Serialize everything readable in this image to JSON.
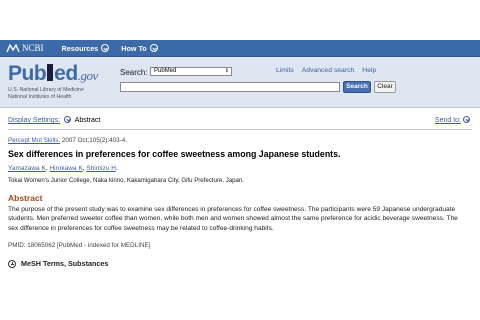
{
  "topbar": {
    "ncbi_label": "NCBI",
    "menus": [
      "Resources",
      "How To"
    ]
  },
  "header": {
    "logo_left": "Pub",
    "logo_right": "ed",
    "logo_gov": ".gov",
    "logo_sub1": "U.S. National Library of Medicine",
    "logo_sub2": "National Institutes of Health",
    "search_label": "Search:",
    "db_selected": "PubMed",
    "links": [
      "Limits",
      "Advanced search",
      "Help"
    ],
    "search_value": "",
    "search_button": "Search",
    "clear_button": "Clear"
  },
  "settings": {
    "display_settings": "Display Settings:",
    "format": "Abstract",
    "send_to": "Send to:"
  },
  "article": {
    "journal": "Percept Mot Skills.",
    "citation": "2007 Oct;105(2):403-4.",
    "title": "Sex differences in preferences for coffee sweetness among Japanese students.",
    "authors": [
      "Yamazawa K",
      "Hirokawa K",
      "Shimizu H"
    ],
    "affiliation": "Tokai Women's Junior College, Naka kirino, Kakamigahara City, Gifu Prefecture, Japan.",
    "abstract_heading": "Abstract",
    "abstract": "The purpose of the present study was to examine sex differences in preferences for coffee sweetness. The participants were 59 Japanese undergraduate students. Men preferred sweeter coffee than women, while both men and women showed almost the same preference for acidic beverage sweetness. The sex difference in preferences for coffee sweetness may be related to coffee-drinking habits.",
    "pmid": "PMID: 18065062 [PubMed - indexed for MEDLINE]",
    "mesh": "MeSH Terms, Substances"
  },
  "colors": {
    "topbar": "#3b6aa9",
    "header_bg": "#dde6f1",
    "link": "#3f5ea8",
    "abstract_heading": "#9b4b1f"
  }
}
